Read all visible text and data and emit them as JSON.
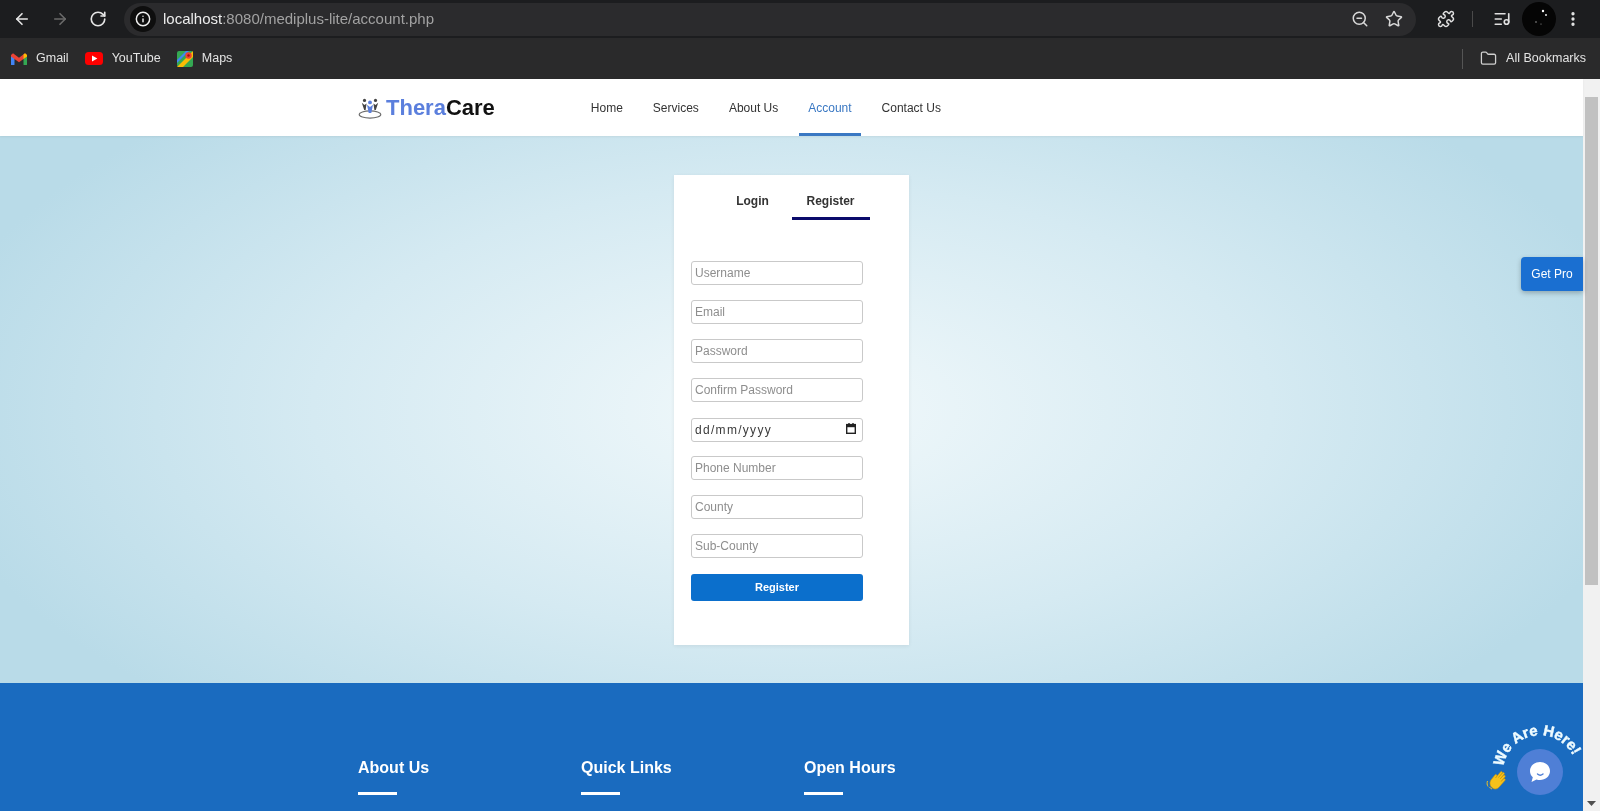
{
  "browser": {
    "nav_buttons": [
      {
        "kind": "back",
        "disabled": false
      },
      {
        "kind": "forward",
        "disabled": true
      },
      {
        "kind": "reload",
        "disabled": false
      }
    ],
    "url": {
      "host": "localhost",
      "path": ":8080/mediplus-lite/account.php"
    },
    "bookmarks": [
      {
        "kind": "gmail",
        "label": "Gmail"
      },
      {
        "kind": "youtube",
        "label": "YouTube"
      },
      {
        "kind": "maps",
        "label": "Maps"
      }
    ],
    "all_bookmarks": "All Bookmarks"
  },
  "header": {
    "logo": {
      "first": "Thera",
      "second": "Care"
    },
    "nav": [
      {
        "label": "Home",
        "selected": false
      },
      {
        "label": "Services",
        "selected": false
      },
      {
        "label": "About Us",
        "selected": false
      },
      {
        "label": "Account",
        "selected": true
      },
      {
        "label": "Contact Us",
        "selected": false
      }
    ]
  },
  "account_card": {
    "tabs": [
      {
        "label": "Login",
        "selected": false
      },
      {
        "label": "Register",
        "selected": true
      }
    ],
    "fields": [
      {
        "kind": "text",
        "placeholder": "Username"
      },
      {
        "kind": "text",
        "placeholder": "Email"
      },
      {
        "kind": "text",
        "placeholder": "Password"
      },
      {
        "kind": "text",
        "placeholder": "Confirm Password"
      },
      {
        "kind": "date",
        "placeholder": "dd/mm/yyyy"
      },
      {
        "kind": "text",
        "placeholder": "Phone Number"
      },
      {
        "kind": "text",
        "placeholder": "County"
      },
      {
        "kind": "text",
        "placeholder": "Sub-County"
      }
    ],
    "submit": "Register"
  },
  "get_pro": "Get Pro",
  "footer": {
    "columns": [
      {
        "title": "About Us"
      },
      {
        "title": "Quick Links"
      },
      {
        "title": "Open Hours"
      }
    ]
  },
  "chat_widget": {
    "caption": "We Are Here!"
  }
}
